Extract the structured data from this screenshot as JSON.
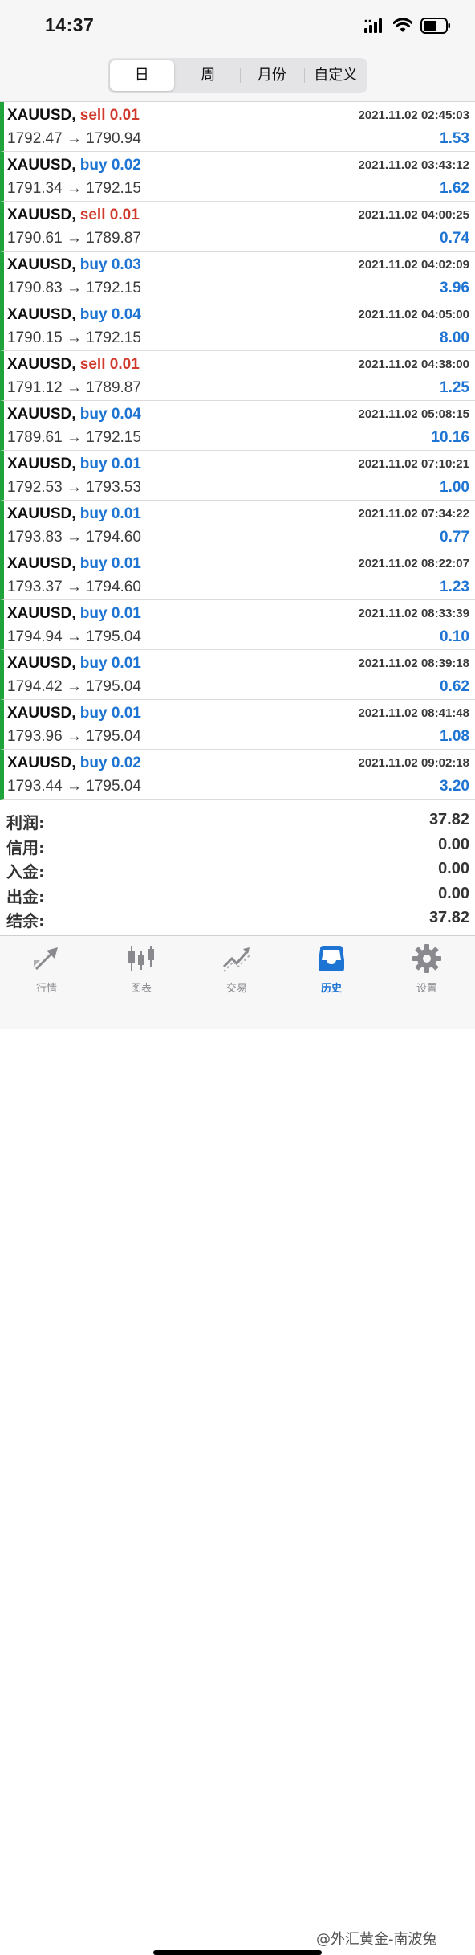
{
  "status_bar": {
    "time": "14:37"
  },
  "period_tabs": {
    "items": [
      {
        "label": "日",
        "active": true
      },
      {
        "label": "周",
        "active": false
      },
      {
        "label": "月份",
        "active": false
      },
      {
        "label": "自定义",
        "active": false
      }
    ]
  },
  "trades": [
    {
      "symbol": "XAUUSD,",
      "action": "sell",
      "lots": "0.01",
      "date": "2021.11.02 02:45:03",
      "open": "1792.47",
      "close": "1790.94",
      "profit": "1.53"
    },
    {
      "symbol": "XAUUSD,",
      "action": "buy",
      "lots": "0.02",
      "date": "2021.11.02 03:43:12",
      "open": "1791.34",
      "close": "1792.15",
      "profit": "1.62"
    },
    {
      "symbol": "XAUUSD,",
      "action": "sell",
      "lots": "0.01",
      "date": "2021.11.02 04:00:25",
      "open": "1790.61",
      "close": "1789.87",
      "profit": "0.74"
    },
    {
      "symbol": "XAUUSD,",
      "action": "buy",
      "lots": "0.03",
      "date": "2021.11.02 04:02:09",
      "open": "1790.83",
      "close": "1792.15",
      "profit": "3.96"
    },
    {
      "symbol": "XAUUSD,",
      "action": "buy",
      "lots": "0.04",
      "date": "2021.11.02 04:05:00",
      "open": "1790.15",
      "close": "1792.15",
      "profit": "8.00"
    },
    {
      "symbol": "XAUUSD,",
      "action": "sell",
      "lots": "0.01",
      "date": "2021.11.02 04:38:00",
      "open": "1791.12",
      "close": "1789.87",
      "profit": "1.25"
    },
    {
      "symbol": "XAUUSD,",
      "action": "buy",
      "lots": "0.04",
      "date": "2021.11.02 05:08:15",
      "open": "1789.61",
      "close": "1792.15",
      "profit": "10.16"
    },
    {
      "symbol": "XAUUSD,",
      "action": "buy",
      "lots": "0.01",
      "date": "2021.11.02 07:10:21",
      "open": "1792.53",
      "close": "1793.53",
      "profit": "1.00"
    },
    {
      "symbol": "XAUUSD,",
      "action": "buy",
      "lots": "0.01",
      "date": "2021.11.02 07:34:22",
      "open": "1793.83",
      "close": "1794.60",
      "profit": "0.77"
    },
    {
      "symbol": "XAUUSD,",
      "action": "buy",
      "lots": "0.01",
      "date": "2021.11.02 08:22:07",
      "open": "1793.37",
      "close": "1794.60",
      "profit": "1.23"
    },
    {
      "symbol": "XAUUSD,",
      "action": "buy",
      "lots": "0.01",
      "date": "2021.11.02 08:33:39",
      "open": "1794.94",
      "close": "1795.04",
      "profit": "0.10"
    },
    {
      "symbol": "XAUUSD,",
      "action": "buy",
      "lots": "0.01",
      "date": "2021.11.02 08:39:18",
      "open": "1794.42",
      "close": "1795.04",
      "profit": "0.62"
    },
    {
      "symbol": "XAUUSD,",
      "action": "buy",
      "lots": "0.01",
      "date": "2021.11.02 08:41:48",
      "open": "1793.96",
      "close": "1795.04",
      "profit": "1.08"
    },
    {
      "symbol": "XAUUSD,",
      "action": "buy",
      "lots": "0.02",
      "date": "2021.11.02 09:02:18",
      "open": "1793.44",
      "close": "1795.04",
      "profit": "3.20"
    }
  ],
  "price_arrow": "→",
  "summary": [
    {
      "label": "利润:",
      "value": "37.82"
    },
    {
      "label": "信用:",
      "value": "0.00"
    },
    {
      "label": "入金:",
      "value": "0.00"
    },
    {
      "label": "出金:",
      "value": "0.00"
    },
    {
      "label": "结余:",
      "value": "37.82"
    }
  ],
  "tab_bar": {
    "items": [
      {
        "label": "行情",
        "icon": "quotes-arrows-icon",
        "active": false
      },
      {
        "label": "图表",
        "icon": "candlestick-chart-icon",
        "active": false
      },
      {
        "label": "交易",
        "icon": "trade-trend-icon",
        "active": false
      },
      {
        "label": "历史",
        "icon": "history-inbox-icon",
        "active": true
      },
      {
        "label": "设置",
        "icon": "gear-icon",
        "active": false
      }
    ]
  },
  "watermark": "@外汇黄金-南波兔",
  "colors": {
    "buy": "#1e74d3",
    "sell": "#d03a2c",
    "row_indicator": "#1ea43a",
    "active_tab": "#1e74d3",
    "inactive_tab": "#8a8a8e"
  }
}
